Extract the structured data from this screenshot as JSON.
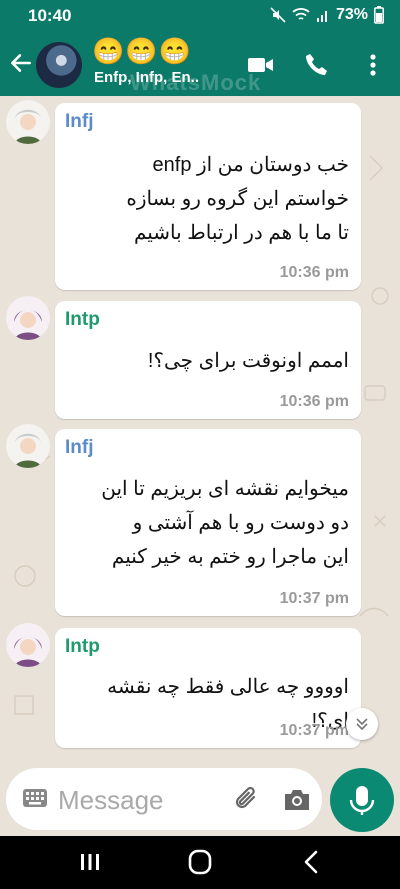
{
  "status": {
    "time": "10:40",
    "battery": "73%"
  },
  "header": {
    "emojis": "😁😁😁",
    "members": "Enfp, Infp, En..",
    "watermark": "WhatsMock"
  },
  "messages": [
    {
      "sender": "Infj",
      "sender_color": "#5b8bc9",
      "text": "خب دوستان من از enfp\nخواستم این گروه رو بسازه\nتا ما با هم در ارتباط باشیم",
      "time": "10:36 pm"
    },
    {
      "sender": "Intp",
      "sender_color": "#1f9a6d",
      "text": "اممم اونوقت برای چی؟!",
      "time": "10:36 pm"
    },
    {
      "sender": "Infj",
      "sender_color": "#5b8bc9",
      "text": "میخوایم نقشه ای بریزیم تا این\nدو دوست رو با هم آشتی و\nاین ماجرا رو ختم به خیر کنیم",
      "time": "10:37 pm"
    },
    {
      "sender": "Intp",
      "sender_color": "#1f9a6d",
      "text": "اوووو چه عالی فقط چه نقشه\nای؟!",
      "time": "10:37 pm"
    }
  ],
  "composer": {
    "placeholder": "Message"
  },
  "colors": {
    "header_bg": "#0b7a68",
    "mic_bg": "#0b8a73",
    "chat_bg": "#e9e2d8"
  }
}
